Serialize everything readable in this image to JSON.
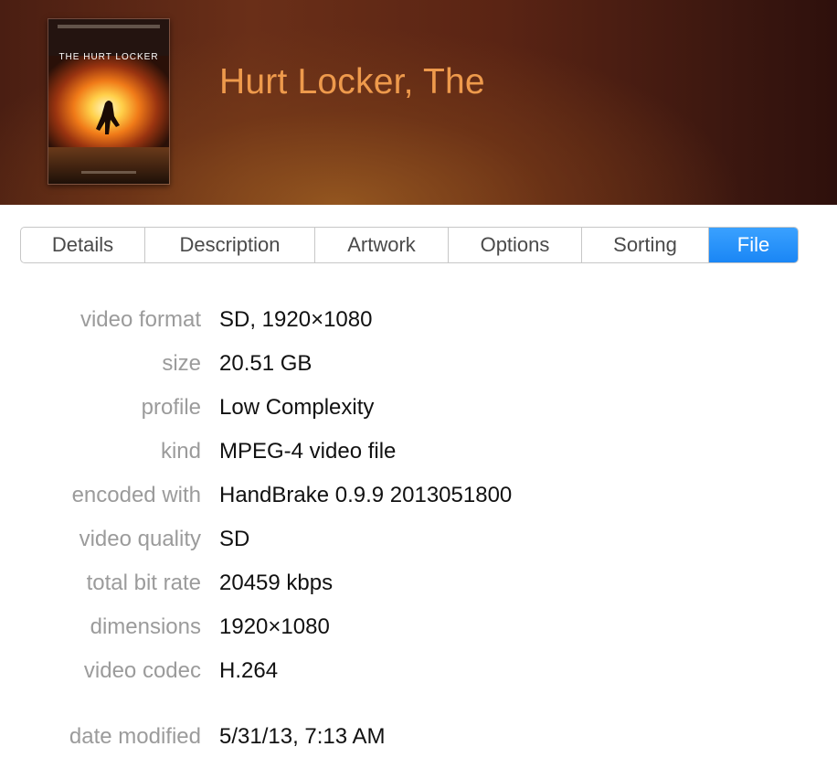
{
  "movie": {
    "title": "Hurt Locker, The",
    "poster_title": "THE HURT LOCKER"
  },
  "tabs": [
    {
      "label": "Details",
      "active": false
    },
    {
      "label": "Description",
      "active": false
    },
    {
      "label": "Artwork",
      "active": false
    },
    {
      "label": "Options",
      "active": false
    },
    {
      "label": "Sorting",
      "active": false
    },
    {
      "label": "File",
      "active": true
    }
  ],
  "file_info": [
    {
      "label": "video format",
      "value": "SD, 1920×1080"
    },
    {
      "label": "size",
      "value": "20.51 GB"
    },
    {
      "label": "profile",
      "value": "Low Complexity"
    },
    {
      "label": "kind",
      "value": "MPEG-4 video file"
    },
    {
      "label": "encoded with",
      "value": "HandBrake 0.9.9 2013051800"
    },
    {
      "label": "video quality",
      "value": "SD"
    },
    {
      "label": "total bit rate",
      "value": "20459 kbps"
    },
    {
      "label": "dimensions",
      "value": "1920×1080"
    },
    {
      "label": "video codec",
      "value": "H.264"
    },
    {
      "label": "date modified",
      "value": "5/31/13, 7:13 AM"
    }
  ],
  "colors": {
    "title": "#ee9a4c",
    "tab_active": "#1a86f5",
    "label": "#9b9b9b"
  }
}
